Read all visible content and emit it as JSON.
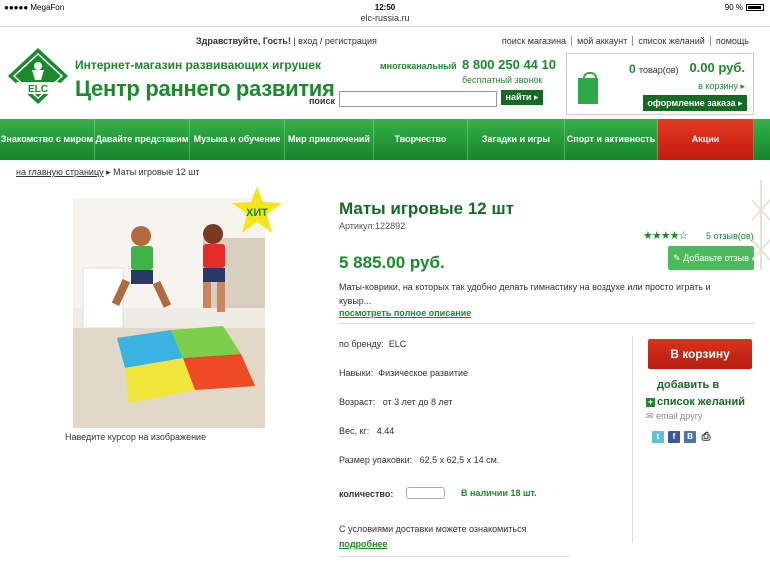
{
  "status_bar": {
    "carrier": "●●●●● MegaFon",
    "time": "12:50",
    "battery": "90 %"
  },
  "url": "elc-russia.ru",
  "header": {
    "greeting": "Здравствуйте, Гость!",
    "login": "вход / регистрация",
    "util_links": [
      "поиск магазина",
      "мой аккаунт",
      "список желаний",
      "помощь"
    ],
    "logo_text": "ELC",
    "slogan": "Интернет-магазин развивающих игрушек",
    "brand": "Центр раннего развития",
    "phone_label": "многоканальный",
    "phone": "8 800 250 44 10",
    "free_call": "бесплатный звонок",
    "search_label": "поиск",
    "search_placeholder": "",
    "search_button": "найти ▸"
  },
  "cart": {
    "count": "0",
    "count_unit": "товар(ов)",
    "sum": "0.00 руб.",
    "link": "в корзину ▸",
    "checkout": "оформление заказа ▸"
  },
  "nav": [
    {
      "label": "Знакомство с миром"
    },
    {
      "label": "Давайте представим"
    },
    {
      "label": "Музыка и обучение"
    },
    {
      "label": "Мир приключений"
    },
    {
      "label": "Творчество"
    },
    {
      "label": "Загадки и игры"
    },
    {
      "label": "Спорт и активность"
    },
    {
      "label": "Акции"
    }
  ],
  "breadcrumb": {
    "home": "на главную страницу",
    "sep": "▸",
    "current": "Маты игровые 12 шт"
  },
  "product": {
    "badge": "ХИТ",
    "image_hint": "Наведите курсор на изображение",
    "title": "Маты игровые 12 шт",
    "sku": "Артикул:122892",
    "price": "5 885.00 руб.",
    "rating": 4,
    "rating_stars": "★★★★☆",
    "reviews": "5 отзыв(ов)",
    "add_review": "Добавьте отзыв",
    "description": "Маты-коврики, на которых так удобно делать гимнастику на воздухе или просто играть и кувыр...",
    "full_description_link": "посмотреть полное описание",
    "attributes": [
      {
        "label": "по бренду:",
        "value": "ELC"
      },
      {
        "label": "Навыки:",
        "value": "Физическое развитие"
      },
      {
        "label": "Возраст:",
        "value": "от 3 лет до 8 лет"
      },
      {
        "label": "Вес, кг:",
        "value": "4.44"
      },
      {
        "label": "Размер упаковки:",
        "value": "62,5 х 62,5 х 14 см."
      }
    ],
    "buy_button": "В корзину",
    "wishlist_plus": "+",
    "wishlist": "добавить в список желаний",
    "email_friend": "✉ email другу",
    "social": [
      "t",
      "f",
      "B",
      "⎙"
    ],
    "quantity_label": "количество:",
    "quantity_value": "",
    "stock": "В наличии 18 шт.",
    "delivery": "С условиями доставки можете ознакомиться",
    "delivery_more": "подробнее"
  },
  "colors": {
    "brand_green": "#1a8a2c",
    "dark_green": "#146b24",
    "sale_red": "#c21b10"
  }
}
